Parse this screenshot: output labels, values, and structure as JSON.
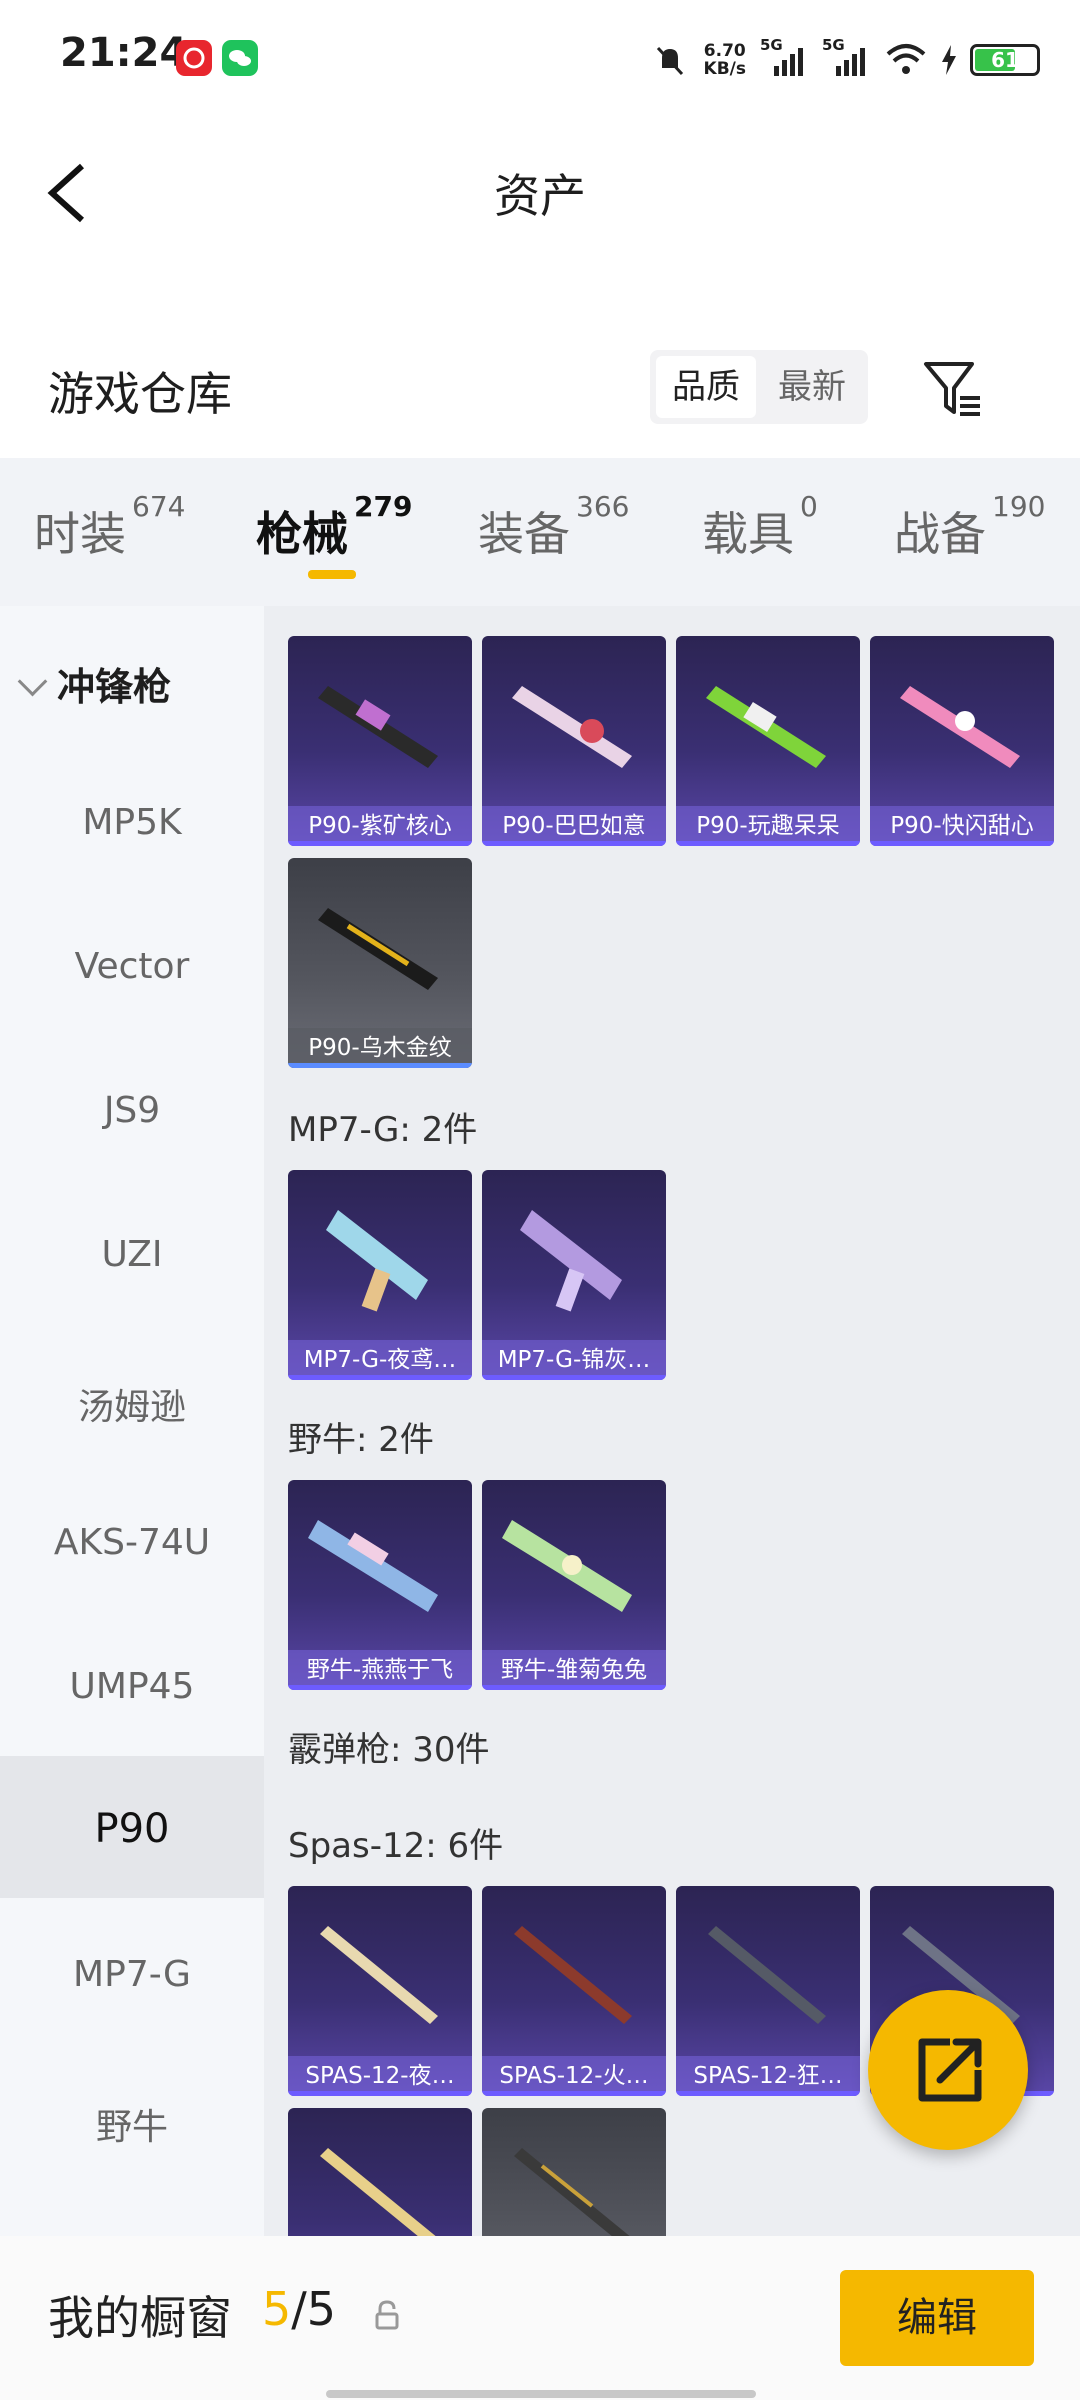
{
  "status_bar": {
    "time": "21:24",
    "net_speed": "6.70",
    "net_unit": "KB/s",
    "sig1": "5G",
    "sig2": "5G",
    "battery": "61"
  },
  "header": {
    "title": "资产"
  },
  "warehouse": {
    "title": "游戏仓库",
    "sort_quality": "品质",
    "sort_newest": "最新"
  },
  "tabs": [
    {
      "label": "时装",
      "count": "674"
    },
    {
      "label": "枪械",
      "count": "279"
    },
    {
      "label": "装备",
      "count": "366"
    },
    {
      "label": "载具",
      "count": "0"
    },
    {
      "label": "战备",
      "count": "190"
    }
  ],
  "sidebar": {
    "category": "冲锋枪",
    "items": [
      "MP5K",
      "Vector",
      "JS9",
      "UZI",
      "汤姆逊",
      "AKS-74U",
      "UMP45",
      "P90",
      "MP7-G",
      "野牛"
    ],
    "selected": "P90"
  },
  "groups": {
    "p90": [
      "P90-紫矿核心",
      "P90-巴巴如意",
      "P90-玩趣呆呆",
      "P90-快闪甜心",
      "P90-乌木金纹"
    ],
    "mp7_title": "MP7-G: 2件",
    "mp7": [
      "MP7-G-夜鸢…",
      "MP7-G-锦灰…"
    ],
    "bison_title": "野牛: 2件",
    "bison": [
      "野牛-燕燕于飞",
      "野牛-雏菊兔兔"
    ],
    "shotgun_title": "霰弹枪: 30件",
    "spas_title": "Spas-12: 6件",
    "spas": [
      "SPAS-12-夜…",
      "SPAS-12-火…",
      "SPAS-12-狂…"
    ]
  },
  "bottom": {
    "showcase": "我的橱窗",
    "count_current": "5",
    "count_sep": "/",
    "count_total": "5",
    "edit": "编辑"
  },
  "colors": {
    "accent": "#f5b800",
    "card_purple": "#3a2f73"
  }
}
